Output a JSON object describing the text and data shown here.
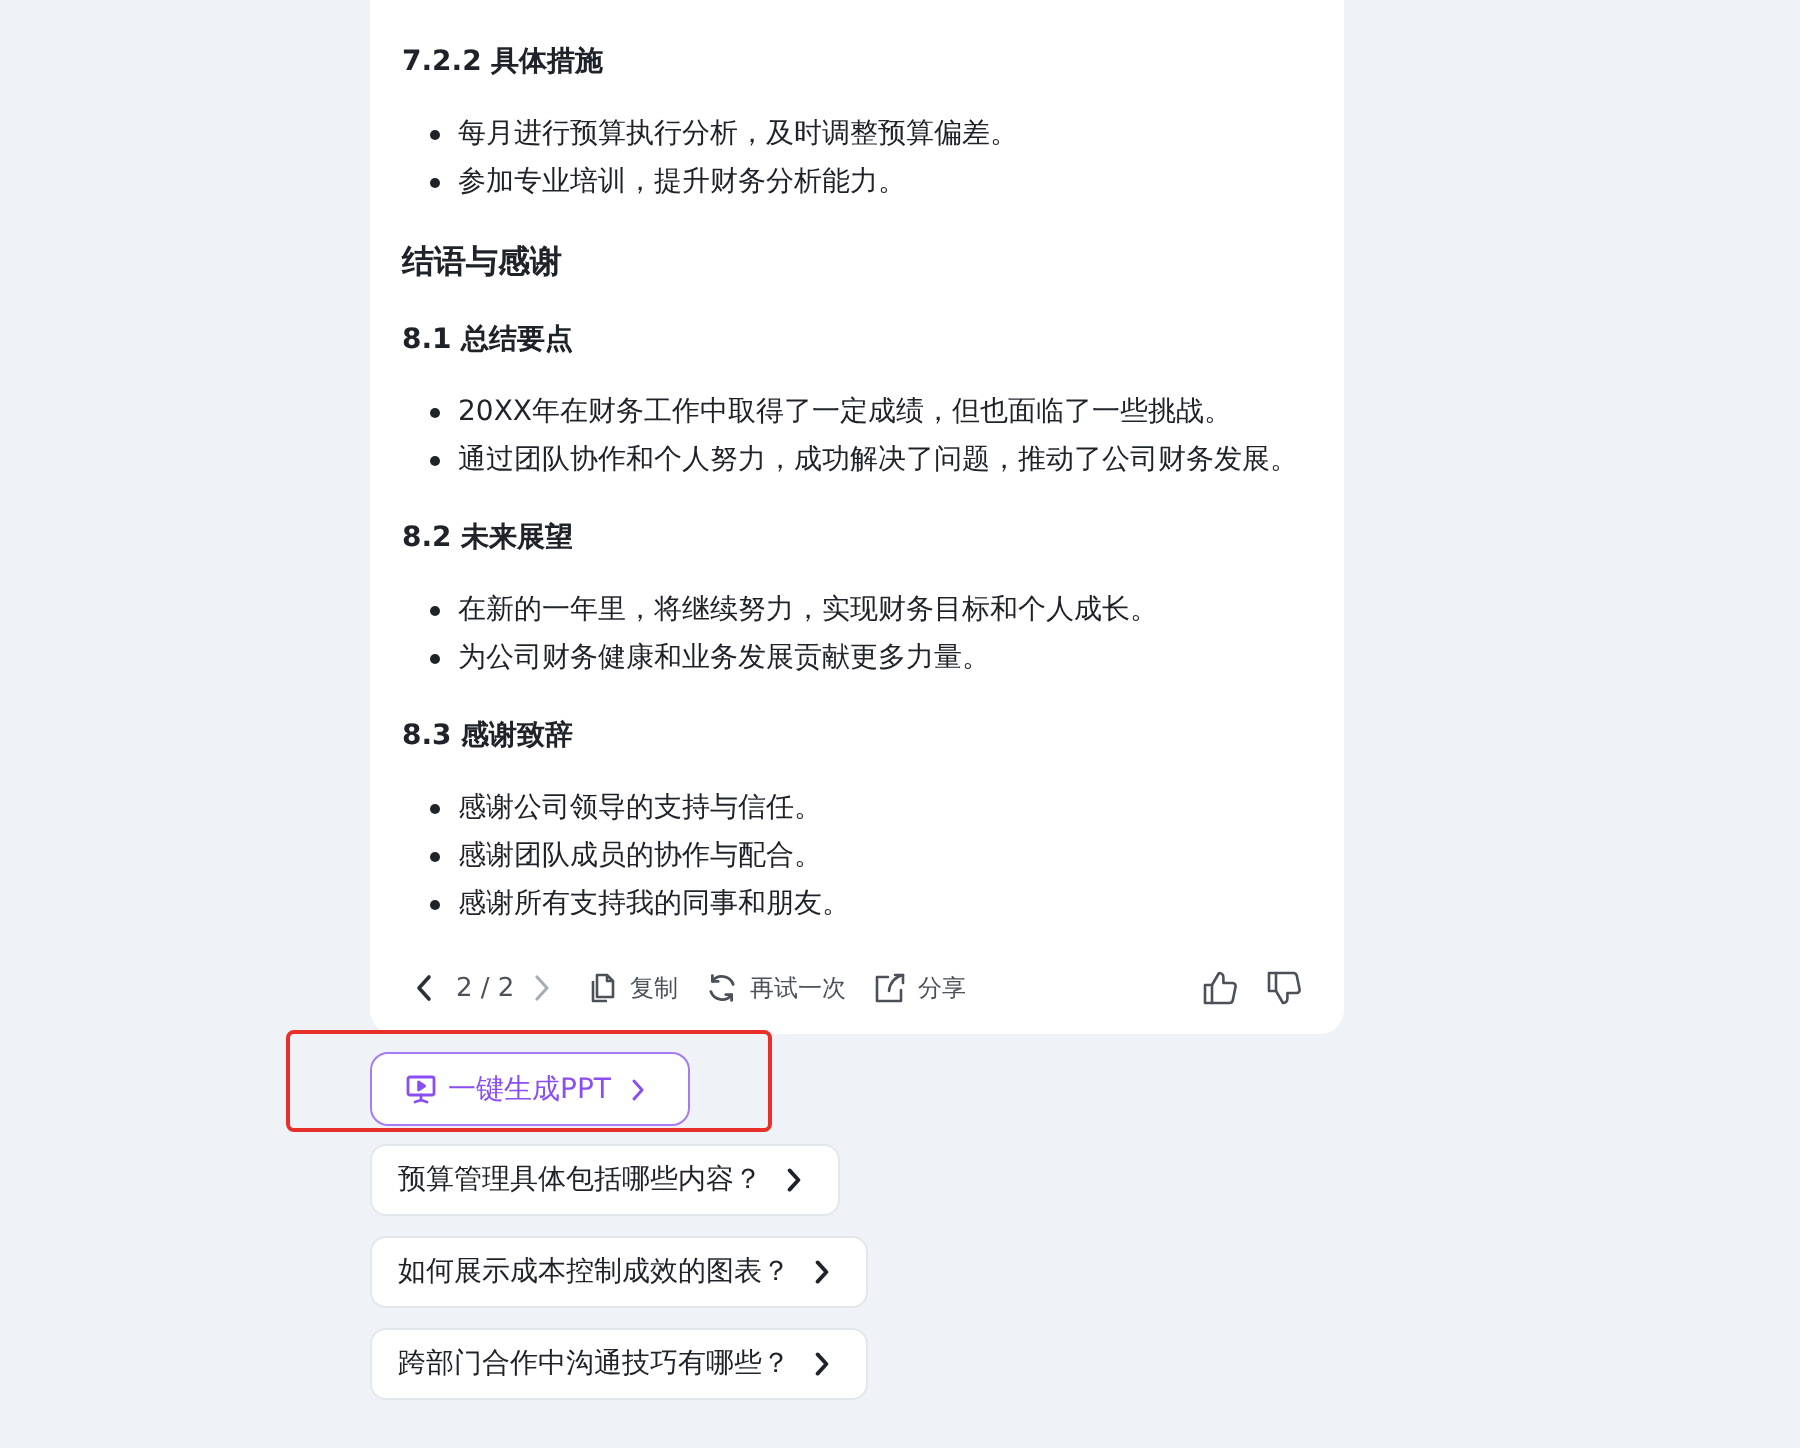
{
  "answer": {
    "blocks": [
      {
        "kind": "subheading",
        "text": "7.2.2 具体措施"
      },
      {
        "kind": "list",
        "items": [
          "每月进行预算执行分析，及时调整预算偏差。",
          "参加专业培训，提升财务分析能力。"
        ]
      },
      {
        "kind": "heading",
        "text": "结语与感谢"
      },
      {
        "kind": "subheading",
        "text": "8.1 总结要点"
      },
      {
        "kind": "list",
        "items": [
          "20XX年在财务工作中取得了一定成绩，但也面临了一些挑战。",
          "通过团队协作和个人努力，成功解决了问题，推动了公司财务发展。"
        ]
      },
      {
        "kind": "subheading",
        "text": "8.2 未来展望"
      },
      {
        "kind": "list",
        "items": [
          "在新的一年里，将继续努力，实现财务目标和个人成长。",
          "为公司财务健康和业务发展贡献更多力量。"
        ]
      },
      {
        "kind": "subheading",
        "text": "8.3 感谢致辞"
      },
      {
        "kind": "list",
        "items": [
          "感谢公司领导的支持与信任。",
          "感谢团队成员的协作与配合。",
          "感谢所有支持我的同事和朋友。"
        ]
      }
    ],
    "toolbar": {
      "prev": {
        "disabled": false
      },
      "counter": "2 / 2",
      "next": {
        "disabled": true
      },
      "actions": [
        {
          "kind": "copy",
          "label": "复制"
        },
        {
          "kind": "retry",
          "label": "再试一次"
        },
        {
          "kind": "share",
          "label": "分享"
        }
      ]
    }
  },
  "ppt_button": {
    "label": "一键生成PPT",
    "highlighted": true
  },
  "suggestions": [
    "预算管理具体包括哪些内容？",
    "如何展示成本控制成效的图表？",
    "跨部门合作中沟通技巧有哪些？"
  ]
}
